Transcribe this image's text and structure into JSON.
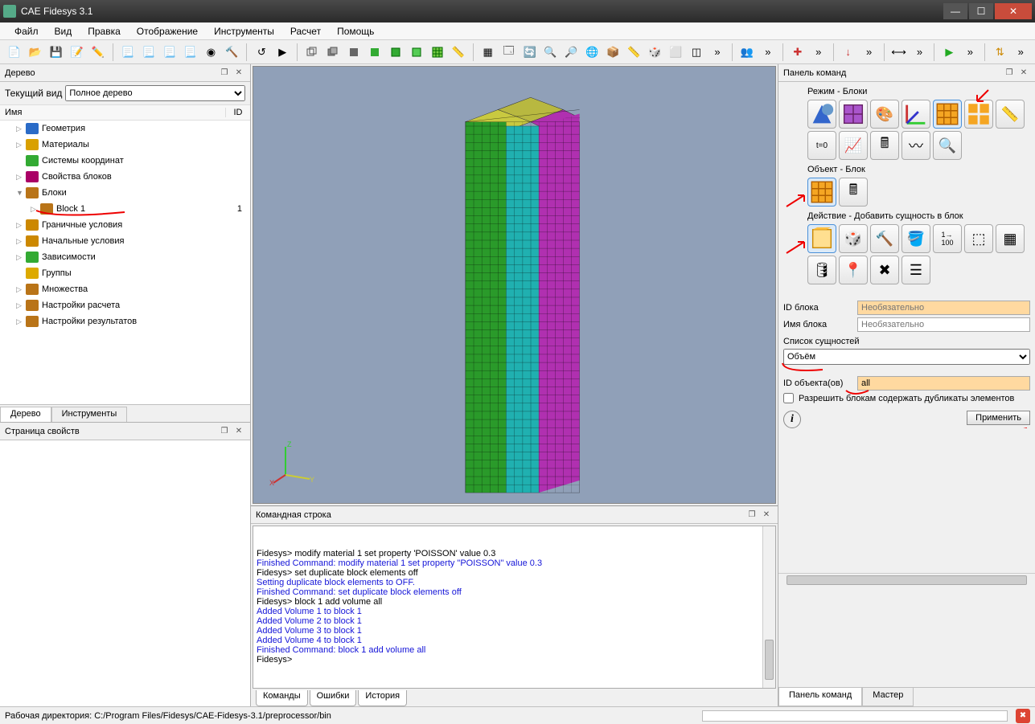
{
  "window": {
    "title": "CAE Fidesys 3.1"
  },
  "menu": [
    "Файл",
    "Вид",
    "Правка",
    "Отображение",
    "Инструменты",
    "Расчет",
    "Помощь"
  ],
  "tree_panel": {
    "title": "Дерево",
    "view_label": "Текущий вид",
    "view_value": "Полное дерево",
    "col_name": "Имя",
    "col_id": "ID",
    "items": [
      {
        "label": "Геометрия",
        "level": 1,
        "arrow": "▷",
        "icon": "geom"
      },
      {
        "label": "Материалы",
        "level": 1,
        "arrow": "▷",
        "icon": "mat"
      },
      {
        "label": "Системы координат",
        "level": 1,
        "arrow": "",
        "icon": "coord"
      },
      {
        "label": "Свойства блоков",
        "level": 1,
        "arrow": "▷",
        "icon": "prop"
      },
      {
        "label": "Блоки",
        "level": 1,
        "arrow": "▼",
        "icon": "block"
      },
      {
        "label": "Block 1",
        "level": 2,
        "arrow": "▷",
        "icon": "block",
        "id": "1"
      },
      {
        "label": "Граничные условия",
        "level": 1,
        "arrow": "▷",
        "icon": "bc"
      },
      {
        "label": "Начальные условия",
        "level": 1,
        "arrow": "▷",
        "icon": "ic"
      },
      {
        "label": "Зависимости",
        "level": 1,
        "arrow": "▷",
        "icon": "dep"
      },
      {
        "label": "Группы",
        "level": 1,
        "arrow": "",
        "icon": "grp"
      },
      {
        "label": "Множества",
        "level": 1,
        "arrow": "▷",
        "icon": "set"
      },
      {
        "label": "Настройки расчета",
        "level": 1,
        "arrow": "▷",
        "icon": "calc"
      },
      {
        "label": "Настройки результатов",
        "level": 1,
        "arrow": "▷",
        "icon": "res"
      }
    ],
    "tabs": [
      "Дерево",
      "Инструменты"
    ]
  },
  "props_panel": {
    "title": "Страница свойств"
  },
  "cmd_panel": {
    "title": "Командная строка",
    "tabs": [
      "Команды",
      "Ошибки",
      "История"
    ],
    "lines": [
      {
        "t": "Fidesys> modify material 1 set property 'POISSON' value 0.3",
        "c": "prompt"
      },
      {
        "t": "Finished Command: modify material 1 set property \"POISSON\" value 0.3",
        "c": "out"
      },
      {
        "t": "",
        "c": "prompt"
      },
      {
        "t": "Fidesys> set duplicate block elements off",
        "c": "prompt"
      },
      {
        "t": "Setting duplicate block elements to OFF.",
        "c": "out"
      },
      {
        "t": "Finished Command: set duplicate block elements off",
        "c": "out"
      },
      {
        "t": "",
        "c": "prompt"
      },
      {
        "t": "Fidesys> block 1 add volume all",
        "c": "prompt"
      },
      {
        "t": "Added Volume 1 to block 1",
        "c": "out"
      },
      {
        "t": "Added Volume 2 to block 1",
        "c": "out"
      },
      {
        "t": "Added Volume 3 to block 1",
        "c": "out"
      },
      {
        "t": "Added Volume 4 to block 1",
        "c": "out"
      },
      {
        "t": "Finished Command: block 1 add volume all",
        "c": "out"
      },
      {
        "t": "",
        "c": "prompt"
      },
      {
        "t": "Fidesys>",
        "c": "prompt"
      }
    ]
  },
  "right_panel": {
    "title": "Панель команд",
    "mode_label": "Режим - Блоки",
    "object_label": "Объект - Блок",
    "action_label": "Действие - Добавить сущность в блок",
    "form": {
      "block_id_label": "ID блока",
      "block_id_placeholder": "Необязательно",
      "block_name_label": "Имя блока",
      "block_name_placeholder": "Необязательно",
      "entity_list_label": "Список сущностей",
      "entity_type": "Объём",
      "obj_id_label": "ID объекта(ов)",
      "obj_id_value": "all",
      "dup_label": "Разрешить блокам содержать дубликаты элементов",
      "apply": "Применить"
    },
    "tabs": [
      "Панель команд",
      "Мастер"
    ]
  },
  "statusbar": {
    "text": "Рабочая директория: C:/Program Files/Fidesys/CAE-Fidesys-3.1/preprocessor/bin"
  }
}
